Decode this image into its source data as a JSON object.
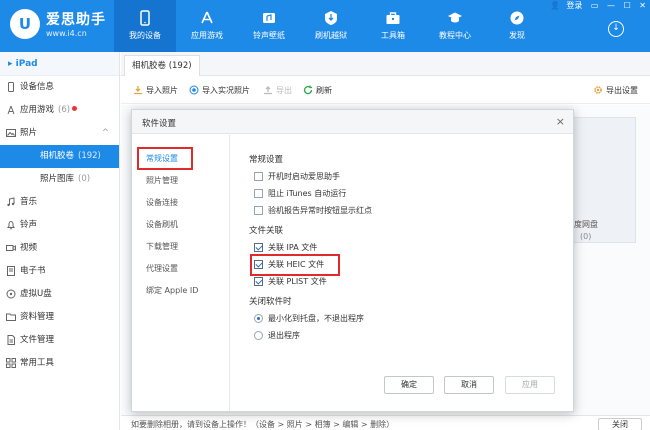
{
  "app": {
    "logo_text": "U",
    "title": "爱思助手",
    "url": "www.i4.cn"
  },
  "nav": [
    {
      "label": "我的设备",
      "icon": "phone-icon"
    },
    {
      "label": "应用游戏",
      "icon": "app-store-icon"
    },
    {
      "label": "铃声壁纸",
      "icon": "ringtone-icon"
    },
    {
      "label": "刷机越狱",
      "icon": "flash-icon"
    },
    {
      "label": "工具箱",
      "icon": "toolbox-icon"
    },
    {
      "label": "教程中心",
      "icon": "graduation-icon"
    },
    {
      "label": "发现",
      "icon": "compass-icon"
    }
  ],
  "window": {
    "login": "登录",
    "controls": [
      "▭",
      "—",
      "☐",
      "✕"
    ]
  },
  "sidebar": {
    "device": "iPad",
    "items": [
      {
        "label": "设备信息"
      },
      {
        "label": "应用游戏",
        "count": "(6)"
      },
      {
        "label": "照片"
      },
      {
        "label": "相机胶卷",
        "count": "(192)"
      },
      {
        "label": "照片图库",
        "count": "(0)"
      },
      {
        "label": "音乐"
      },
      {
        "label": "铃声"
      },
      {
        "label": "视频"
      },
      {
        "label": "电子书"
      },
      {
        "label": "虚拟U盘"
      },
      {
        "label": "资料管理"
      },
      {
        "label": "文件管理"
      },
      {
        "label": "常用工具"
      }
    ]
  },
  "main": {
    "tab": "相机胶卷 (192)",
    "toolbar": {
      "import_photos": "导入照片",
      "import_live": "导入实况照片",
      "export": "导出",
      "refresh": "刷新",
      "export_settings": "导出设置"
    },
    "album": {
      "name": "百度网盘",
      "count": "(0)"
    },
    "bottom_text": "如要删除相册，请到设备上操作！（设备 > 照片 > 相簿 > 编辑 > 删除）",
    "bottom_button": "关闭"
  },
  "dialog": {
    "title": "软件设置",
    "close": "×",
    "nav": [
      "常规设置",
      "照片管理",
      "设备连接",
      "设备刷机",
      "下载管理",
      "代理设置",
      "绑定 Apple ID"
    ],
    "general": {
      "title": "常规设置",
      "options": [
        {
          "label": "开机时启动爱思助手",
          "checked": false
        },
        {
          "label": "阻止 iTunes 自动运行",
          "checked": false
        },
        {
          "label": "验机报告异常时按钮显示红点",
          "checked": false
        }
      ]
    },
    "file_assoc": {
      "title": "文件关联",
      "options": [
        {
          "label": "关联 IPA 文件",
          "checked": true
        },
        {
          "label": "关联 HEIC 文件",
          "checked": true
        },
        {
          "label": "关联 PLIST 文件",
          "checked": true
        }
      ]
    },
    "close_app": {
      "title": "关闭软件时",
      "options": [
        {
          "label": "最小化到托盘，不退出程序",
          "selected": true
        },
        {
          "label": "退出程序",
          "selected": false
        }
      ]
    },
    "buttons": {
      "ok": "确定",
      "cancel": "取消",
      "apply": "应用"
    }
  },
  "colors": {
    "brand": "#1e8ae8",
    "highlight": "#e02b2b"
  }
}
